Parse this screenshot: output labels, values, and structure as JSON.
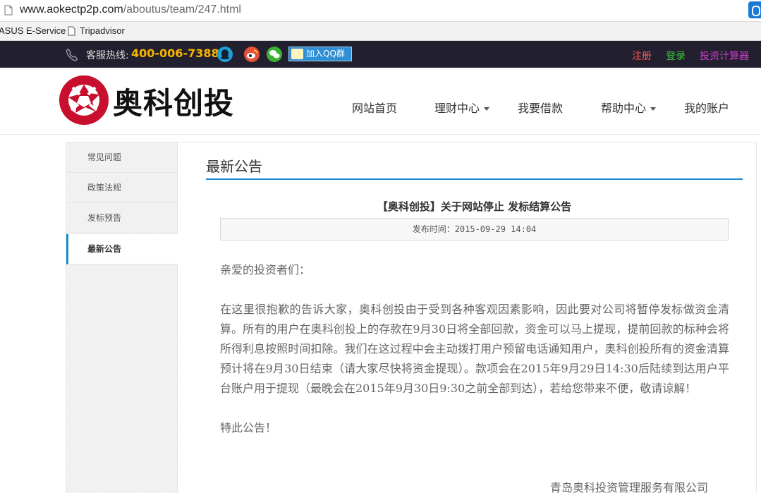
{
  "browser": {
    "url_host": "www.aokectp2p.com",
    "url_path": "/aboutus/team/247.html",
    "bookmarks": [
      "ASUS E-Service",
      "Tripadvisor"
    ]
  },
  "topbar": {
    "hotline_label": "客服热线:",
    "hotline_number": "400-006-7388",
    "qq_group_label": "加入QQ群",
    "links": {
      "register": "注册",
      "login": "登录",
      "calculator": "投资计算器"
    },
    "colors": {
      "bg": "#221f2e",
      "hotline": "#f7b500",
      "register": "#ff5a5a",
      "login": "#3fc33f",
      "calculator": "#d23dd2"
    }
  },
  "header": {
    "logo_text": "奥科创投",
    "nav": {
      "home": "网站首页",
      "finance": "理财中心",
      "borrow": "我要借款",
      "help": "帮助中心",
      "account": "我的账户"
    }
  },
  "sidebar": {
    "items": [
      "常见问题",
      "政策法规",
      "发标预告",
      "最新公告"
    ],
    "active_index": 3,
    "accent": "#1a8ccf"
  },
  "content": {
    "section_title": "最新公告",
    "article_title": "【奥科创投】关于网站停止 发标结算公告",
    "publish_time": "发布时间：2015-09-29 14:04",
    "greeting": "亲爱的投资者们：",
    "body": "在这里很抱歉的告诉大家，奥科创投由于受到各种客观因素影响，因此要对公司将暂停发标做资金清算。所有的用户在奥科创投上的存款在9月30日将全部回款，资金可以马上提现，提前回款的标种会将所得利息按照时间扣除。我们在这过程中会主动拨打用户预留电话通知用户，奥科创投所有的资金清算预计将在9月30日结束（请大家尽快将资金提现）。款项会在2015年9月29日14:30后陆续到达用户平台账户用于提现（最晚会在2015年9月30日9:30之前全部到达），若给您带来不便，敬请谅解！",
    "closing": "特此公告！",
    "signature": "青岛奥科投资管理服务有限公司"
  }
}
